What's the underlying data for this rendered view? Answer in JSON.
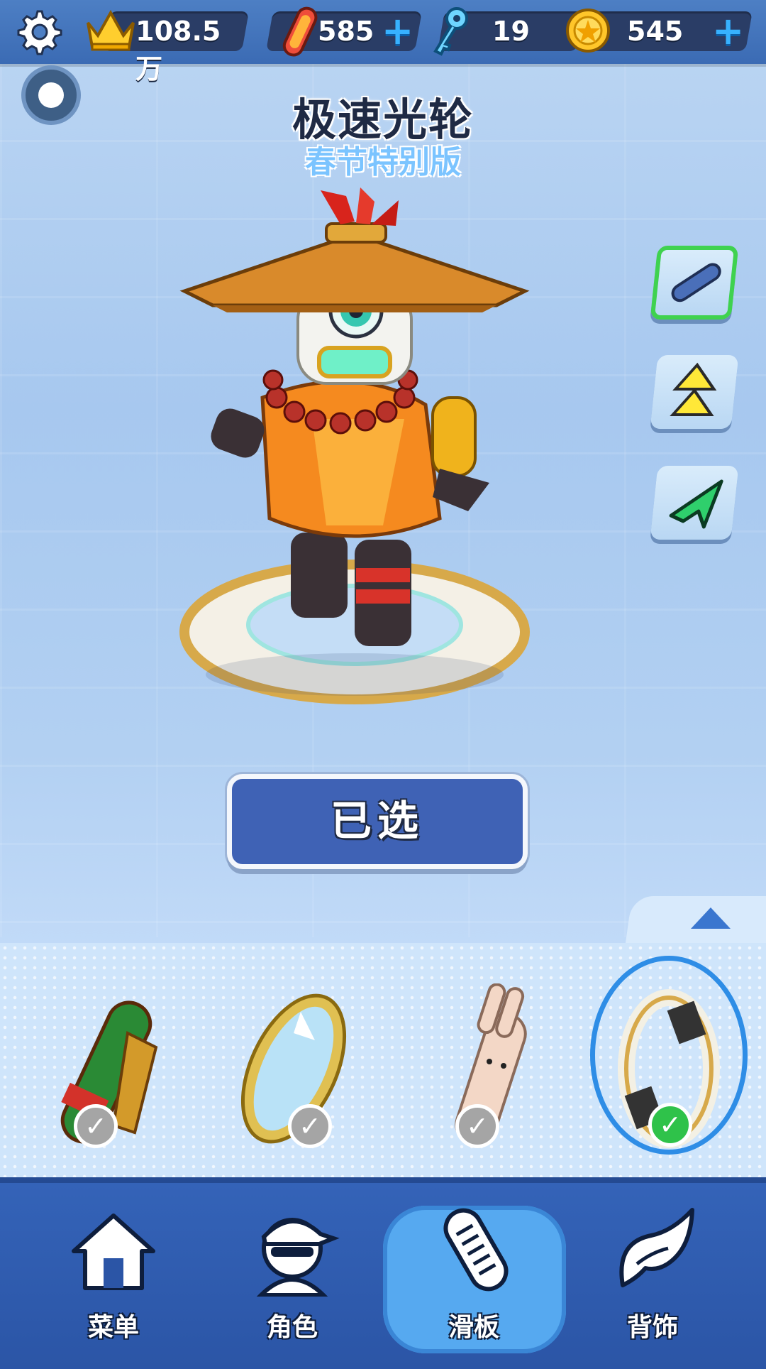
{
  "currency": {
    "score": "108.5万",
    "boards": "585",
    "keys": "19",
    "coins": "545"
  },
  "title": "极速光轮",
  "subtitle": "春节特别版",
  "select_button": "已选",
  "nav": {
    "menu": "菜单",
    "character": "角色",
    "board": "滑板",
    "accessory": "背饰"
  },
  "colors": {
    "accent_blue": "#3f62b5",
    "plus_blue": "#37b2ff",
    "check_green": "#2fc24a"
  }
}
